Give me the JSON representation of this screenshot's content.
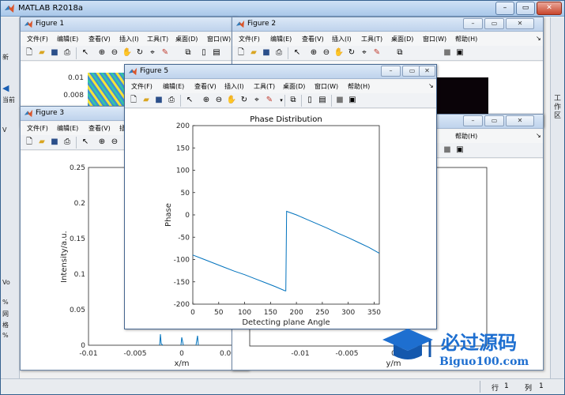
{
  "app": {
    "title": "MATLAB R2018a"
  },
  "main_left_labels": [
    "新",
    "当前",
    "V",
    "Vo",
    "%",
    "网",
    "格",
    "%"
  ],
  "main_right_label": "工作区",
  "status": {
    "row_label": "行",
    "row_value": "1",
    "col_label": "列",
    "col_value": "1"
  },
  "menu": [
    "文件(F)",
    "编辑(E)",
    "查看(V)",
    "插入(I)",
    "工具(T)",
    "桌面(D)",
    "窗口(W)",
    "帮助(H)"
  ],
  "figures": {
    "fig1": {
      "title": "Figure 1",
      "tick_values": [
        "0.01",
        "0.008"
      ]
    },
    "fig2": {
      "title": "Figure 2"
    },
    "fig3": {
      "title": "Figure 3",
      "ylabel": "Intensity/a.u.",
      "xlabel": "x/m",
      "yticks": [
        "0.25",
        "0.2",
        "0.15",
        "0.1",
        "0.05",
        "0"
      ],
      "xticks": [
        "-0.01",
        "-0.005",
        "0",
        "0.00"
      ]
    },
    "fig4": {
      "xlabel": "y/m",
      "xticks": [
        "-0.01",
        "-0.005",
        "0"
      ]
    },
    "fig5": {
      "title": "Figure 5"
    }
  },
  "colors": {
    "line": "#0072bd",
    "titlebar_active": "#bfd3ec",
    "desktop": "#6f9fc8"
  },
  "watermark": {
    "cn": "必过源码",
    "url": "Biguo100.com"
  },
  "chart_data": {
    "type": "line",
    "title": "Phase Distribution",
    "xlabel": "Detecting plane Angle",
    "ylabel": "Phase",
    "xlim": [
      0,
      360
    ],
    "ylim": [
      -200,
      200
    ],
    "xticks": [
      0,
      50,
      100,
      150,
      200,
      250,
      300,
      350
    ],
    "yticks": [
      -200,
      -150,
      -100,
      -50,
      0,
      50,
      100,
      150,
      200
    ],
    "grid": false,
    "series": [
      {
        "x": [
          0,
          20,
          40,
          60,
          80,
          100,
          120,
          140,
          160,
          178,
          179.5,
          181,
          200,
          220,
          240,
          260,
          280,
          300,
          320,
          340,
          360
        ],
        "y": [
          -90,
          -99,
          -108,
          -117,
          -126,
          -134,
          -143,
          -152,
          -161,
          -170,
          -170,
          8,
          0,
          -10,
          -20,
          -30,
          -41,
          -51,
          -62,
          -73,
          -86
        ]
      }
    ]
  }
}
